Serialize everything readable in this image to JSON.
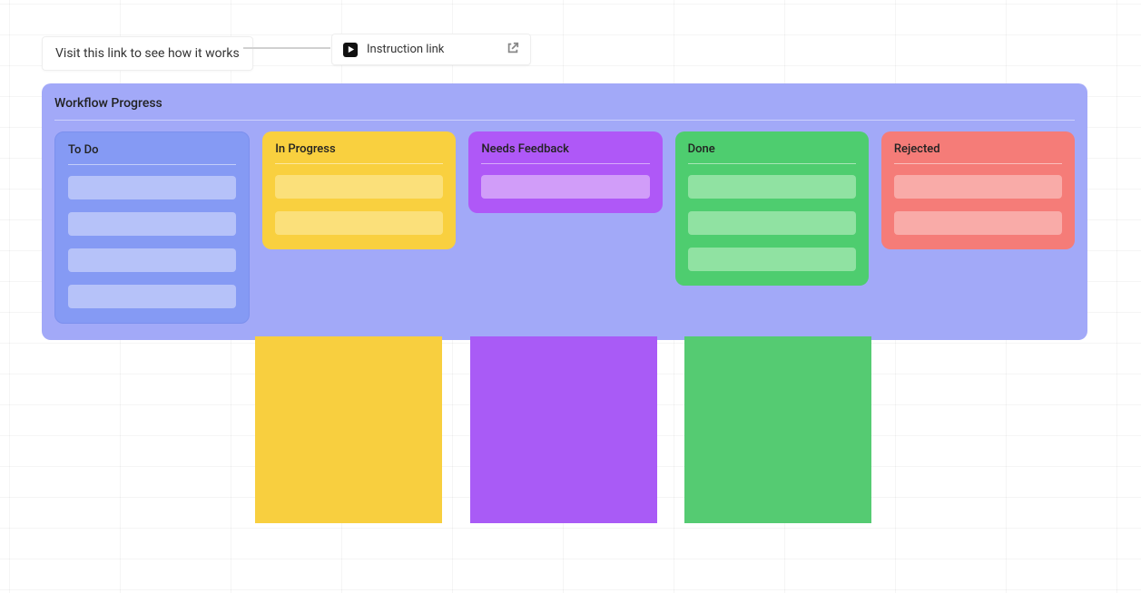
{
  "textCard": {
    "text": "Visit this link to see how it works"
  },
  "linkCard": {
    "label": "Instruction link"
  },
  "board": {
    "title": "Workflow Progress",
    "columns": [
      {
        "id": "todo",
        "label": "To Do",
        "colorClass": "col-todo",
        "tickets": 4
      },
      {
        "id": "progress",
        "label": "In Progress",
        "colorClass": "col-progress",
        "tickets": 2
      },
      {
        "id": "feedback",
        "label": "Needs Feedback",
        "colorClass": "col-feedback",
        "tickets": 1
      },
      {
        "id": "done",
        "label": "Done",
        "colorClass": "col-done",
        "tickets": 3
      },
      {
        "id": "rejected",
        "label": "Rejected",
        "colorClass": "col-rejected",
        "tickets": 2
      }
    ]
  },
  "swatches": [
    {
      "id": "yellow",
      "class": "sw-yellow"
    },
    {
      "id": "purple",
      "class": "sw-purple"
    },
    {
      "id": "green",
      "class": "sw-green"
    }
  ]
}
